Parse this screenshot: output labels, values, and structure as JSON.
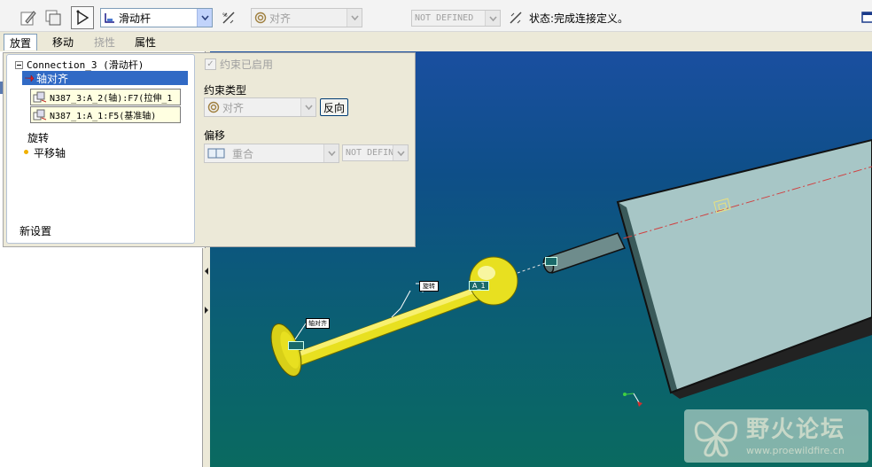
{
  "toolbar": {
    "connection_type": "滑动杆",
    "constraint_type": "对齐",
    "offset_value": "NOT DEFINED",
    "status_text": "状态:完成连接定义。"
  },
  "tabs": [
    {
      "label": "放置"
    },
    {
      "label": "移动"
    },
    {
      "label": "挠性"
    },
    {
      "label": "属性"
    }
  ],
  "tree": {
    "root": "Connection_3 (滑动杆)",
    "selected": "轴对齐",
    "references": [
      "N387_3:A_2(轴):F7(拉伸_1",
      "N387_1:A_1:F5(基准轴)"
    ],
    "items": [
      "旋转",
      "平移轴"
    ],
    "new_set": "新设置"
  },
  "constraint": {
    "enabled_label": "约束已启用",
    "type_label": "约束类型",
    "type_value": "对齐",
    "flip_button": "反向",
    "offset_label": "偏移",
    "offset_type": "重合",
    "offset_value": "NOT DEFINED"
  },
  "scene_labels": {
    "axis_align": "轴对齐",
    "rotate": "旋转",
    "axis_a1": "A_1"
  },
  "watermark": {
    "title": "野火论坛",
    "url": "www.proewildfire.cn"
  },
  "colors": {
    "selection": "#316ac5",
    "part_yellow": "#e8e020",
    "block_face": "#9fc2c2"
  }
}
